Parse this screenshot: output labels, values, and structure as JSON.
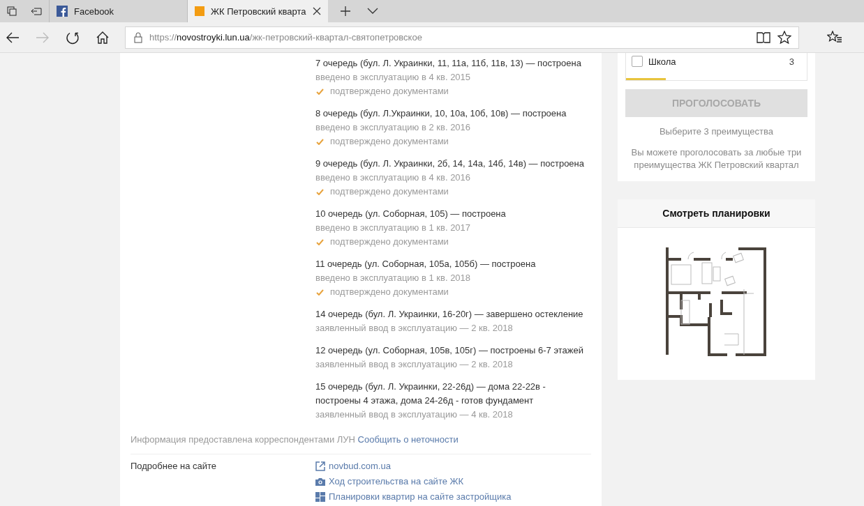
{
  "browser": {
    "tabs": [
      {
        "title": "Facebook",
        "selected": false
      },
      {
        "title": "ЖК Петровский кварта",
        "selected": true
      }
    ],
    "address": {
      "scheme": "https://",
      "host": "novostroyki.lun.ua",
      "path": "/жк-петровский-квартал-святопетровское"
    },
    "forward_disabled": true
  },
  "stages": [
    {
      "title": "7 очередь (бул. Л. Украинки, 11, 11а, 11б, 11в, 13) — построена",
      "status": "введено в эксплуатацию в 4 кв. 2015",
      "confirmed": true,
      "confirmation": "подтверждено документами"
    },
    {
      "title": "8 очередь (бул. Л.Украинки, 10, 10а, 10б, 10в) — построена",
      "status": "введено в эксплуатацию в 2 кв. 2016",
      "confirmed": true,
      "confirmation": "подтверждено документами"
    },
    {
      "title": "9 очередь (бул. Л. Украинки, 2б, 14, 14а, 14б, 14в) — построена",
      "status": "введено в эксплуатацию в 4 кв. 2016",
      "confirmed": true,
      "confirmation": "подтверждено документами"
    },
    {
      "title": "10 очередь (ул. Соборная, 105) — построена",
      "status": "введено в эксплуатацию в 1 кв. 2017",
      "confirmed": true,
      "confirmation": "подтверждено документами"
    },
    {
      "title": "11 очередь (ул. Соборная, 105а, 105б) — построена",
      "status": "введено в эксплуатацию в 1 кв. 2018",
      "confirmed": true,
      "confirmation": "подтверждено документами"
    },
    {
      "title": "14 очередь (бул. Л. Украинки, 16-20г) — завершено остекление",
      "status": "заявленный ввод в эксплуатацию — 2 кв. 2018",
      "confirmed": false
    },
    {
      "title": "12 очередь (ул. Соборная, 105в, 105г) — построены 6-7 этажей",
      "status": "заявленный ввод в эксплуатацию — 2 кв. 2018",
      "confirmed": false
    },
    {
      "title": "15 очередь (бул. Л. Украинки, 22-26д) — дома 22-22в - построены 4 этажа, дома 24-26д - готов фундамент",
      "status": "заявленный ввод в эксплуатацию — 4 кв. 2018",
      "confirmed": false
    }
  ],
  "info": {
    "text": "Информация предоставлена корреспондентами ЛУН",
    "link": "Сообщить о неточности"
  },
  "more": {
    "label": "Подробнее на сайте",
    "links": [
      {
        "text": "novbud.com.ua"
      },
      {
        "text": "Ход строительства на сайте ЖК"
      },
      {
        "text": "Планировки квартир на сайте застройщика"
      }
    ]
  },
  "vote": {
    "options": [
      {
        "label": "Школа",
        "count": "3",
        "checked": false
      }
    ],
    "level": 0.22,
    "button": "ПРОГОЛОСОВАТЬ",
    "button_disabled": true,
    "hint": "Выберите 3 преимущества",
    "note": "Вы можете проголосовать за любые три преимущества ЖК Петровский квартал"
  },
  "plans": {
    "title": "Смотреть планировки"
  }
}
